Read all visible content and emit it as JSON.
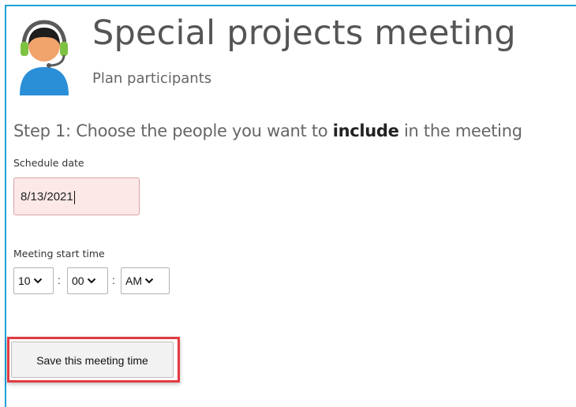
{
  "header": {
    "title": "Special projects meeting",
    "subtitle": "Plan participants",
    "avatar_icon": "support-agent-headset-icon"
  },
  "step": {
    "prefix": "Step 1: Choose the people you want to ",
    "emphasis": "include",
    "suffix": " in the meeting"
  },
  "schedule": {
    "label": "Schedule date",
    "value": "8/13/2021"
  },
  "start_time": {
    "label": "Meeting start time",
    "hour": "10",
    "minute": "00",
    "ampm": "AM",
    "separator": ":"
  },
  "actions": {
    "save_label": "Save this meeting time"
  },
  "colors": {
    "frame_accent": "#1aa1d9",
    "input_error_bg": "#fde8e8",
    "highlight_border": "#e23b41"
  }
}
